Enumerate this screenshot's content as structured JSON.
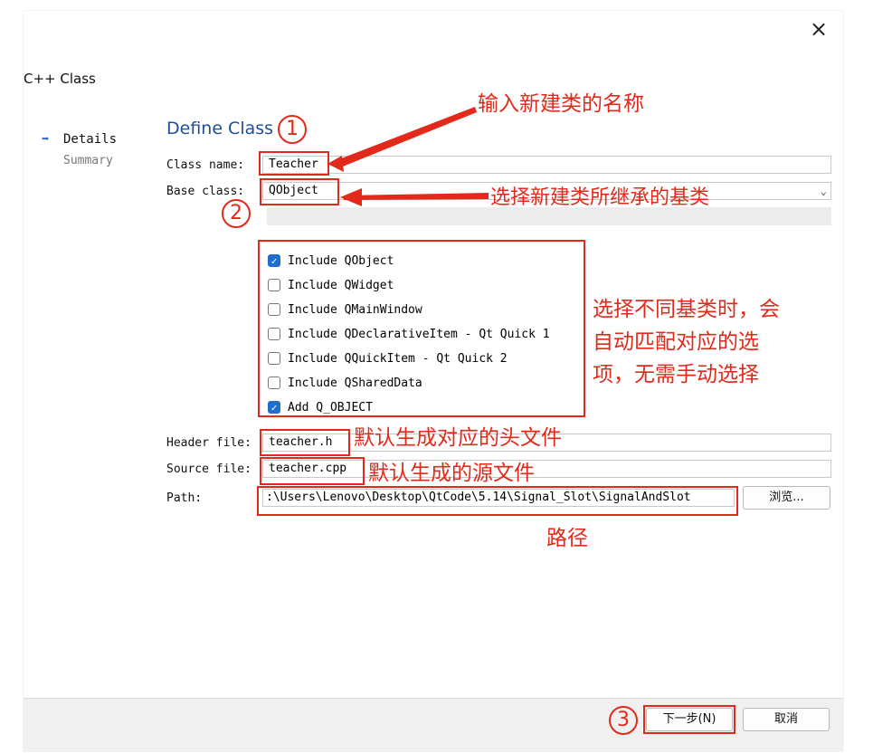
{
  "window": {
    "title": "C++ Class"
  },
  "steps": [
    {
      "label": "Details",
      "active": true
    },
    {
      "label": "Summary",
      "active": false
    }
  ],
  "page": {
    "title": "Define Class"
  },
  "form": {
    "class_name_label": "Class name:",
    "class_name_value": "Teacher",
    "base_class_label": "Base class:",
    "base_class_value": "QObject",
    "options": [
      {
        "label": "Include QObject",
        "checked": true
      },
      {
        "label": "Include QWidget",
        "checked": false
      },
      {
        "label": "Include QMainWindow",
        "checked": false
      },
      {
        "label": "Include QDeclarativeItem - Qt Quick 1",
        "checked": false
      },
      {
        "label": "Include QQuickItem - Qt Quick 2",
        "checked": false
      },
      {
        "label": "Include QSharedData",
        "checked": false
      },
      {
        "label": "Add Q_OBJECT",
        "checked": true
      }
    ],
    "header_file_label": "Header file:",
    "header_file_value": "teacher.h",
    "source_file_label": "Source file:",
    "source_file_value": "teacher.cpp",
    "path_label": "Path:",
    "path_value": ":\\Users\\Lenovo\\Desktop\\QtCode\\5.14\\Signal_Slot\\SignalAndSlot",
    "browse_label": "浏览..."
  },
  "footer": {
    "next_label": "下一步(N)",
    "cancel_label": "取消"
  },
  "annotations": {
    "a1": "输入新建类的名称",
    "a2": "选择新建类所继承的基类",
    "a3_line1": "选择不同基类时，会",
    "a3_line2": "自动匹配对应的选",
    "a3_line3": "项，无需手动选择",
    "a4": "默认生成对应的头文件",
    "a5": "默认生成的源文件",
    "a6": "路径",
    "n1": "1",
    "n2": "2",
    "n3": "3"
  },
  "colors": {
    "annotation_red": "#e22a1a",
    "title_blue": "#1f4e9c",
    "check_blue": "#1f6fcf"
  }
}
